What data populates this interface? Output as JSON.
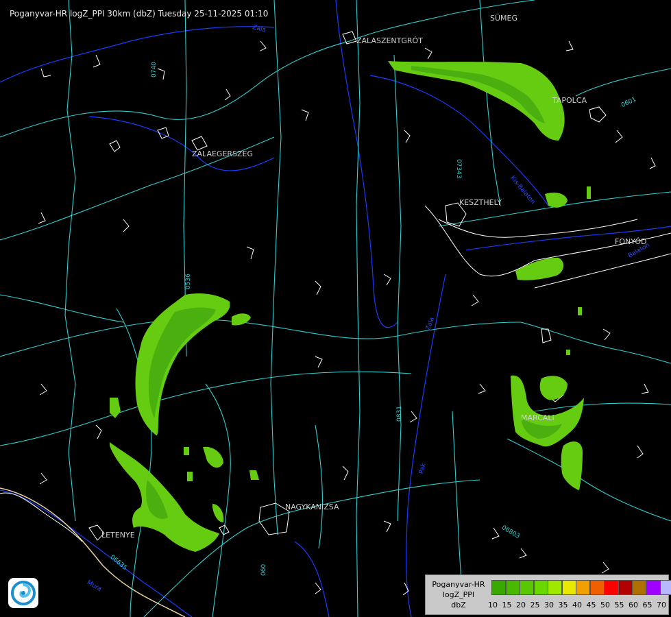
{
  "header": {
    "title": "Poganyvar-HR logZ_PPI 30km (dbZ) Tuesday 25-11-2025 01:10"
  },
  "cities": {
    "sumeg": "SÜMEG",
    "zalaszentgrot": "ZALASZENTGRÓT",
    "tapolca": "TAPOLCA",
    "zalaegerszeg": "ZALAEGERSZEG",
    "keszthely": "KESZTHELY",
    "fonyod": "FONYÓD",
    "marcali": "MARCALI",
    "nagykanizsa": "NAGYKANIZSA",
    "letenye": "LETENYE"
  },
  "roads": {
    "r0740": "0740",
    "r07343": "07343",
    "r0536": "0536",
    "r0831": "0831",
    "r06803": "06803",
    "r06635": "06635",
    "r0601": "0601",
    "r060": "060",
    "r0601b": "0601",
    "r07b": "07"
  },
  "rivers": {
    "zala": "Zala",
    "balaton": "Balaton",
    "pak": "Pak",
    "mura": "Mura",
    "kisbalaton": "Kis-Balaton",
    "ora": "Zala"
  },
  "legend": {
    "line1": "Poganyvar-HR",
    "line2": "logZ_PPI",
    "line3": "dbZ",
    "levels": [
      {
        "label": "10",
        "color": "#39a800"
      },
      {
        "label": "15",
        "color": "#49b800"
      },
      {
        "label": "20",
        "color": "#5ac800"
      },
      {
        "label": "25",
        "color": "#6ad800"
      },
      {
        "label": "30",
        "color": "#a0e800"
      },
      {
        "label": "35",
        "color": "#e8e800"
      },
      {
        "label": "40",
        "color": "#f0a000"
      },
      {
        "label": "45",
        "color": "#f06000"
      },
      {
        "label": "50",
        "color": "#ff0000"
      },
      {
        "label": "55",
        "color": "#b00000"
      },
      {
        "label": "60",
        "color": "#b07000"
      },
      {
        "label": "65",
        "color": "#a000ff"
      },
      {
        "label": "70",
        "color": "#b8b8ff"
      }
    ]
  },
  "colors": {
    "roads": "#2fd0d0",
    "rivers": "#1a3cff",
    "borders": "#ffffff",
    "echo_light": "#66cc11",
    "echo_core": "#4ab010"
  }
}
